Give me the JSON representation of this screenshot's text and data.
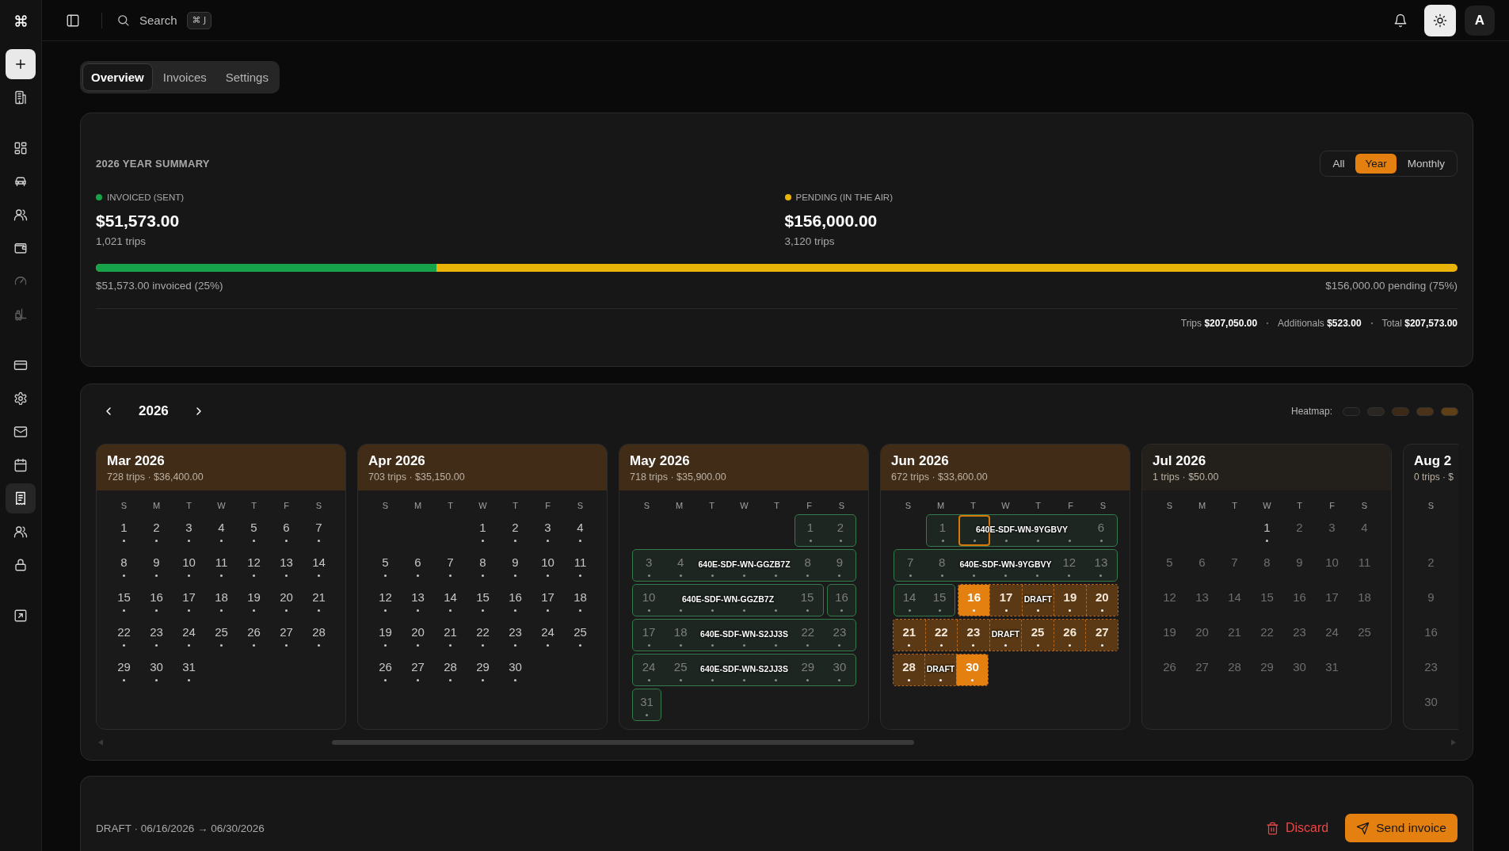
{
  "sidebar": {
    "groups": [
      {
        "items": [
          {
            "selected": false,
            "disabled": false
          }
        ]
      },
      {
        "items": [
          {
            "selected": false,
            "disabled": false
          },
          {
            "selected": false,
            "disabled": false
          },
          {
            "selected": false,
            "disabled": false
          },
          {
            "selected": false,
            "disabled": false
          },
          {
            "selected": false,
            "disabled": true
          },
          {
            "selected": false,
            "disabled": true
          }
        ]
      },
      {
        "items": [
          {
            "selected": false,
            "disabled": false
          },
          {
            "selected": false,
            "disabled": false
          },
          {
            "selected": false,
            "disabled": false
          },
          {
            "selected": false,
            "disabled": false
          },
          {
            "selected": true,
            "disabled": false
          },
          {
            "selected": false,
            "disabled": false
          },
          {
            "selected": false,
            "disabled": false
          }
        ]
      },
      {
        "items": [
          {
            "selected": false,
            "disabled": false
          }
        ]
      }
    ]
  },
  "topbar": {
    "search": {
      "label": "Search",
      "shortcut": "⌘ J"
    },
    "avatar": "A"
  },
  "tabs": [
    {
      "label": "Overview",
      "selected": true
    },
    {
      "label": "Invoices",
      "selected": false
    },
    {
      "label": "Settings",
      "selected": false
    }
  ],
  "summary": {
    "title": "2026 YEAR SUMMARY",
    "ranges": [
      {
        "label": "All",
        "selected": false
      },
      {
        "label": "Year",
        "selected": true
      },
      {
        "label": "Monthly",
        "selected": false
      }
    ],
    "stats": [
      {
        "label": "INVOICED (SENT)",
        "color": "#16a34a",
        "amount": "$51,573.00",
        "trips": "1,021 trips"
      },
      {
        "label": "PENDING (IN THE AIR)",
        "color": "#eab308",
        "amount": "$156,000.00",
        "trips": "3,120 trips"
      }
    ],
    "progress": {
      "level": 0.25,
      "left_label": "$51,573.00 invoiced (25%)",
      "right_label": "$156,000.00 pending (75%)"
    },
    "totals": [
      {
        "label": "Trips",
        "value": "$207,050.00"
      },
      {
        "label": "Additionals",
        "value": "$523.00"
      },
      {
        "label": "Total",
        "value": "$207,573.00"
      }
    ]
  },
  "calendar": {
    "year": "2026",
    "heatmap": {
      "label": "Heatmap:",
      "levels": [
        {
          "color": "#1b1b1b"
        },
        {
          "color": "#2a2621"
        },
        {
          "color": "#3d2916"
        },
        {
          "color": "#4b3218"
        },
        {
          "color": "#5e3f16"
        }
      ]
    },
    "months": [
      {
        "title": "Mar 2026",
        "subtitle": "728 trips · $36,400.00",
        "color": "#402c17",
        "leading_blank_row": false,
        "weekdays": [
          "S",
          "M",
          "T",
          "W",
          "T",
          "F",
          "S"
        ],
        "weeks": [
          {
            "segments": [
              {
                "kind": "plain",
                "cells": [
                  {
                    "day": "1",
                    "dot": true
                  },
                  {
                    "day": "2",
                    "dot": true
                  },
                  {
                    "day": "3",
                    "dot": true
                  },
                  {
                    "day": "4",
                    "dot": true
                  },
                  {
                    "day": "5",
                    "dot": true
                  },
                  {
                    "day": "6",
                    "dot": true
                  },
                  {
                    "day": "7",
                    "dot": true
                  }
                ]
              }
            ]
          },
          {
            "segments": [
              {
                "kind": "plain",
                "cells": [
                  {
                    "day": "8",
                    "dot": true
                  },
                  {
                    "day": "9",
                    "dot": true
                  },
                  {
                    "day": "10",
                    "dot": true
                  },
                  {
                    "day": "11",
                    "dot": true
                  },
                  {
                    "day": "12",
                    "dot": true
                  },
                  {
                    "day": "13",
                    "dot": true
                  },
                  {
                    "day": "14",
                    "dot": true
                  }
                ]
              }
            ]
          },
          {
            "segments": [
              {
                "kind": "plain",
                "cells": [
                  {
                    "day": "15",
                    "dot": true
                  },
                  {
                    "day": "16",
                    "dot": true
                  },
                  {
                    "day": "17",
                    "dot": true
                  },
                  {
                    "day": "18",
                    "dot": true
                  },
                  {
                    "day": "19",
                    "dot": true
                  },
                  {
                    "day": "20",
                    "dot": true
                  },
                  {
                    "day": "21",
                    "dot": true
                  }
                ]
              }
            ]
          },
          {
            "segments": [
              {
                "kind": "plain",
                "cells": [
                  {
                    "day": "22",
                    "dot": true
                  },
                  {
                    "day": "23",
                    "dot": true
                  },
                  {
                    "day": "24",
                    "dot": true
                  },
                  {
                    "day": "25",
                    "dot": true
                  },
                  {
                    "day": "26",
                    "dot": true
                  },
                  {
                    "day": "27",
                    "dot": true
                  },
                  {
                    "day": "28",
                    "dot": true
                  }
                ]
              }
            ]
          },
          {
            "segments": [
              {
                "kind": "plain",
                "cells": [
                  {
                    "day": "29",
                    "dot": true
                  },
                  {
                    "day": "30",
                    "dot": true
                  },
                  {
                    "day": "31",
                    "dot": true
                  }
                ]
              }
            ]
          }
        ]
      },
      {
        "title": "Apr 2026",
        "subtitle": "703 trips · $35,150.00",
        "color": "#402c17",
        "leading_blank_row": false,
        "weekdays": [
          "S",
          "M",
          "T",
          "W",
          "T",
          "F",
          "S"
        ],
        "weeks": [
          {
            "segments": [
              {
                "kind": "plain",
                "cells": [
                  {
                    "day": "1",
                    "dot": true
                  },
                  {
                    "day": "2",
                    "dot": true
                  },
                  {
                    "day": "3",
                    "dot": true
                  },
                  {
                    "day": "4",
                    "dot": true
                  }
                ]
              }
            ]
          },
          {
            "segments": [
              {
                "kind": "plain",
                "cells": [
                  {
                    "day": "5",
                    "dot": true
                  },
                  {
                    "day": "6",
                    "dot": true
                  },
                  {
                    "day": "7",
                    "dot": true
                  },
                  {
                    "day": "8",
                    "dot": true
                  },
                  {
                    "day": "9",
                    "dot": true
                  },
                  {
                    "day": "10",
                    "dot": true
                  },
                  {
                    "day": "11",
                    "dot": true
                  }
                ]
              }
            ]
          },
          {
            "segments": [
              {
                "kind": "plain",
                "cells": [
                  {
                    "day": "12",
                    "dot": true
                  },
                  {
                    "day": "13",
                    "dot": true
                  },
                  {
                    "day": "14",
                    "dot": true
                  },
                  {
                    "day": "15",
                    "dot": true
                  },
                  {
                    "day": "16",
                    "dot": true
                  },
                  {
                    "day": "17",
                    "dot": true
                  },
                  {
                    "day": "18",
                    "dot": true
                  }
                ]
              }
            ]
          },
          {
            "segments": [
              {
                "kind": "plain",
                "cells": [
                  {
                    "day": "19",
                    "dot": true
                  },
                  {
                    "day": "20",
                    "dot": true
                  },
                  {
                    "day": "21",
                    "dot": true
                  },
                  {
                    "day": "22",
                    "dot": true
                  },
                  {
                    "day": "23",
                    "dot": true
                  },
                  {
                    "day": "24",
                    "dot": true
                  },
                  {
                    "day": "25",
                    "dot": true
                  }
                ]
              }
            ]
          },
          {
            "segments": [
              {
                "kind": "plain",
                "cells": [
                  {
                    "day": "26",
                    "dot": true
                  },
                  {
                    "day": "27",
                    "dot": true
                  },
                  {
                    "day": "28",
                    "dot": true
                  },
                  {
                    "day": "29",
                    "dot": true
                  },
                  {
                    "day": "30",
                    "dot": true
                  }
                ]
              }
            ]
          }
        ]
      },
      {
        "title": "May 2026",
        "subtitle": "718 trips · $35,900.00",
        "color": "#402c17",
        "leading_blank_row": false,
        "weekdays": [
          "S",
          "M",
          "T",
          "W",
          "T",
          "F",
          "S"
        ],
        "weeks": [
          {
            "segments": [
              {
                "kind": "invoice",
                "cells": [
                  {
                    "day": "1",
                    "dot": true
                  },
                  {
                    "day": "2",
                    "dot": true
                  }
                ]
              }
            ]
          },
          {
            "segments": [
              {
                "kind": "invoice",
                "label": "640E-SDF-WN-GGZB7Z",
                "cells": [
                  {
                    "day": "3",
                    "dot": true
                  },
                  {
                    "day": "4",
                    "dot": true
                  },
                  {
                    "dot": true
                  },
                  {
                    "dot": true
                  },
                  {
                    "dot": true
                  },
                  {
                    "day": "8",
                    "dot": true
                  },
                  {
                    "day": "9",
                    "dot": true
                  }
                ]
              }
            ]
          },
          {
            "segments": [
              {
                "kind": "invoice",
                "label": "640E-SDF-WN-GGZB7Z",
                "cells": [
                  {
                    "day": "10",
                    "dot": true
                  },
                  {
                    "dot": true
                  },
                  {
                    "dot": true
                  },
                  {
                    "dot": true
                  },
                  {
                    "dot": true
                  },
                  {
                    "day": "15",
                    "dot": true
                  }
                ]
              },
              {
                "kind": "invoice",
                "cells": [
                  {
                    "day": "16",
                    "dot": true
                  }
                ]
              }
            ]
          },
          {
            "segments": [
              {
                "kind": "invoice",
                "label": "640E-SDF-WN-S2JJ3S",
                "cells": [
                  {
                    "day": "17",
                    "dot": true
                  },
                  {
                    "day": "18",
                    "dot": true
                  },
                  {
                    "dot": true
                  },
                  {
                    "dot": true
                  },
                  {
                    "dot": true
                  },
                  {
                    "day": "22",
                    "dot": true
                  },
                  {
                    "day": "23",
                    "dot": true
                  }
                ]
              }
            ]
          },
          {
            "segments": [
              {
                "kind": "invoice",
                "label": "640E-SDF-WN-S2JJ3S",
                "cells": [
                  {
                    "day": "24",
                    "dot": true
                  },
                  {
                    "day": "25",
                    "dot": true
                  },
                  {
                    "dot": true
                  },
                  {
                    "dot": true
                  },
                  {
                    "dot": true
                  },
                  {
                    "day": "29",
                    "dot": true
                  },
                  {
                    "day": "30",
                    "dot": true
                  }
                ]
              }
            ]
          },
          {
            "segments": [
              {
                "kind": "invoice",
                "cells": [
                  {
                    "day": "31",
                    "dot": true
                  }
                ]
              }
            ]
          }
        ]
      },
      {
        "title": "Jun 2026",
        "subtitle": "672 trips · $33,600.00",
        "color": "#402c17",
        "leading_blank_row": false,
        "weekdays": [
          "S",
          "M",
          "T",
          "W",
          "T",
          "F",
          "S"
        ],
        "weeks": [
          {
            "segments": [
              {
                "kind": "invoice",
                "label": "640E-SDF-WN-9YGBVY",
                "cells": [
                  {
                    "day": "1",
                    "dot": true,
                    "outlined": false
                  },
                  {
                    "dot": true,
                    "outlined": true
                  },
                  {
                    "dot": true,
                    "outlined": false
                  },
                  {
                    "dot": true,
                    "outlined": false
                  },
                  {
                    "dot": true,
                    "outlined": false
                  },
                  {
                    "day": "6",
                    "dot": true,
                    "outlined": false
                  }
                ]
              }
            ]
          },
          {
            "segments": [
              {
                "kind": "invoice",
                "label": "640E-SDF-WN-9YGBVY",
                "cells": [
                  {
                    "day": "7",
                    "dot": true
                  },
                  {
                    "day": "8",
                    "dot": true
                  },
                  {
                    "dot": true
                  },
                  {
                    "dot": true
                  },
                  {
                    "dot": true
                  },
                  {
                    "day": "12",
                    "dot": true
                  },
                  {
                    "day": "13",
                    "dot": true
                  }
                ]
              }
            ]
          },
          {
            "segments": [
              {
                "kind": "invoice",
                "cells": [
                  {
                    "day": "14",
                    "dot": true
                  },
                  {
                    "day": "15",
                    "dot": true
                  }
                ]
              },
              {
                "kind": "draft",
                "label": "DRAFT",
                "cells": [
                  {
                    "day": "16",
                    "dot": true,
                    "selected": true
                  },
                  {
                    "day": "17",
                    "dot": true,
                    "selected": false
                  },
                  {
                    "dot": true,
                    "selected": false
                  },
                  {
                    "day": "19",
                    "dot": true,
                    "selected": false
                  },
                  {
                    "day": "20",
                    "dot": true,
                    "selected": false
                  }
                ]
              }
            ]
          },
          {
            "segments": [
              {
                "kind": "draft",
                "label": "DRAFT",
                "cells": [
                  {
                    "day": "21",
                    "dot": true,
                    "selected": false
                  },
                  {
                    "day": "22",
                    "dot": true,
                    "selected": false
                  },
                  {
                    "day": "23",
                    "dot": true,
                    "selected": false
                  },
                  {
                    "dot": true,
                    "selected": false
                  },
                  {
                    "day": "25",
                    "dot": true,
                    "selected": false
                  },
                  {
                    "day": "26",
                    "dot": true,
                    "selected": false
                  },
                  {
                    "day": "27",
                    "dot": true,
                    "selected": false
                  }
                ]
              }
            ]
          },
          {
            "segments": [
              {
                "kind": "draft",
                "label": "DRAFT",
                "cells": [
                  {
                    "day": "28",
                    "dot": true,
                    "selected": false
                  },
                  {
                    "dot": true,
                    "selected": false
                  },
                  {
                    "day": "30",
                    "dot": true,
                    "selected": true
                  }
                ]
              }
            ]
          }
        ]
      },
      {
        "title": "Jul 2026",
        "subtitle": "1 trips · $50.00",
        "color": "#231f1a",
        "leading_blank_row": false,
        "weekdays": [
          "S",
          "M",
          "T",
          "W",
          "T",
          "F",
          "S"
        ],
        "weeks": [
          {
            "segments": [
              {
                "kind": "plain",
                "cells": [
                  {
                    "day": "1",
                    "dot": true
                  },
                  {
                    "day": "2",
                    "dot": false
                  },
                  {
                    "day": "3",
                    "dot": false
                  },
                  {
                    "day": "4",
                    "dot": false
                  }
                ]
              }
            ]
          },
          {
            "segments": [
              {
                "kind": "plain",
                "cells": [
                  {
                    "day": "5",
                    "dot": false
                  },
                  {
                    "day": "6",
                    "dot": false
                  },
                  {
                    "day": "7",
                    "dot": false
                  },
                  {
                    "day": "8",
                    "dot": false
                  },
                  {
                    "day": "9",
                    "dot": false
                  },
                  {
                    "day": "10",
                    "dot": false
                  },
                  {
                    "day": "11",
                    "dot": false
                  }
                ]
              }
            ]
          },
          {
            "segments": [
              {
                "kind": "plain",
                "cells": [
                  {
                    "day": "12",
                    "dot": false
                  },
                  {
                    "day": "13",
                    "dot": false
                  },
                  {
                    "day": "14",
                    "dot": false
                  },
                  {
                    "day": "15",
                    "dot": false
                  },
                  {
                    "day": "16",
                    "dot": false
                  },
                  {
                    "day": "17",
                    "dot": false
                  },
                  {
                    "day": "18",
                    "dot": false
                  }
                ]
              }
            ]
          },
          {
            "segments": [
              {
                "kind": "plain",
                "cells": [
                  {
                    "day": "19",
                    "dot": false
                  },
                  {
                    "day": "20",
                    "dot": false
                  },
                  {
                    "day": "21",
                    "dot": false
                  },
                  {
                    "day": "22",
                    "dot": false
                  },
                  {
                    "day": "23",
                    "dot": false
                  },
                  {
                    "day": "24",
                    "dot": false
                  },
                  {
                    "day": "25",
                    "dot": false
                  }
                ]
              }
            ]
          },
          {
            "segments": [
              {
                "kind": "plain",
                "cells": [
                  {
                    "day": "26",
                    "dot": false
                  },
                  {
                    "day": "27",
                    "dot": false
                  },
                  {
                    "day": "28",
                    "dot": false
                  },
                  {
                    "day": "29",
                    "dot": false
                  },
                  {
                    "day": "30",
                    "dot": false
                  },
                  {
                    "day": "31",
                    "dot": false
                  }
                ]
              }
            ]
          }
        ]
      },
      {
        "title": "Aug 2",
        "subtitle": "0 trips · $",
        "color": "#1a1a1a",
        "leading_blank_row": true,
        "weekdays": [
          "S"
        ],
        "weeks": [
          {
            "segments": [
              {
                "kind": "plain",
                "cells": [
                  {
                    "day": "2",
                    "dot": false
                  }
                ]
              }
            ]
          },
          {
            "segments": [
              {
                "kind": "plain",
                "cells": [
                  {
                    "day": "9",
                    "dot": false
                  }
                ]
              }
            ]
          },
          {
            "segments": [
              {
                "kind": "plain",
                "cells": [
                  {
                    "day": "16",
                    "dot": false
                  }
                ]
              }
            ]
          },
          {
            "segments": [
              {
                "kind": "plain",
                "cells": [
                  {
                    "day": "23",
                    "dot": false
                  }
                ]
              }
            ]
          },
          {
            "segments": [
              {
                "kind": "plain",
                "cells": [
                  {
                    "day": "30",
                    "dot": false
                  }
                ]
              }
            ]
          }
        ]
      }
    ]
  },
  "draft": {
    "title": "DRAFT · 06/16/2026 → 06/30/2026",
    "discard": "Discard",
    "send": "Send invoice"
  }
}
